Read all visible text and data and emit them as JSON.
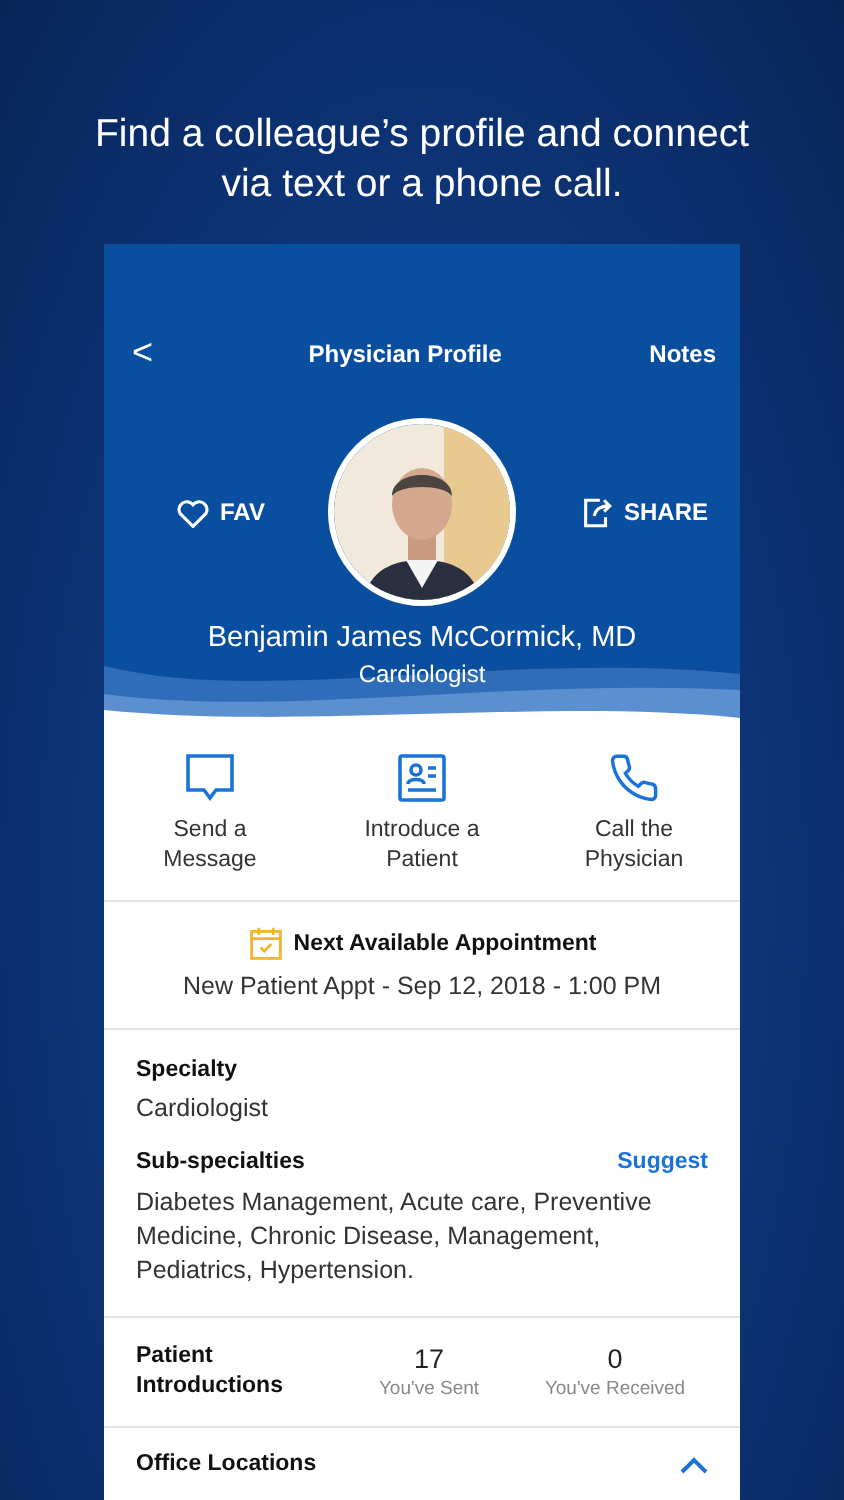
{
  "headline": "Find a colleague’s profile  and connect via text or a phone call.",
  "nav": {
    "back": "<",
    "title": "Physician Profile",
    "action": "Notes"
  },
  "profile": {
    "fav": "FAV",
    "share": "SHARE",
    "name": "Benjamin James McCormick, MD",
    "role": "Cardiologist"
  },
  "actions": [
    {
      "kind": "message",
      "label": "Send a Message"
    },
    {
      "kind": "introduce",
      "label": "Introduce a Patient"
    },
    {
      "kind": "call",
      "label": "Call the Physician"
    }
  ],
  "appointment": {
    "title": "Next Available Appointment",
    "detail": "New Patient Appt - Sep 12, 2018 - 1:00 PM"
  },
  "specialty": {
    "label": "Specialty",
    "value": "Cardiologist"
  },
  "subspecialties": {
    "label": "Sub-specialties",
    "link": "Suggest",
    "value": "Diabetes Management, Acute care, Preventive Medicine, Chronic Disease, Management, Pediatrics, Hypertension."
  },
  "introductions": {
    "label": "Patient Introductions",
    "stats": [
      {
        "value": "17",
        "caption": "You've Sent"
      },
      {
        "value": "0",
        "caption": "You've Received"
      }
    ]
  },
  "office_locations": {
    "label": "Office Locations",
    "expanded": true
  }
}
